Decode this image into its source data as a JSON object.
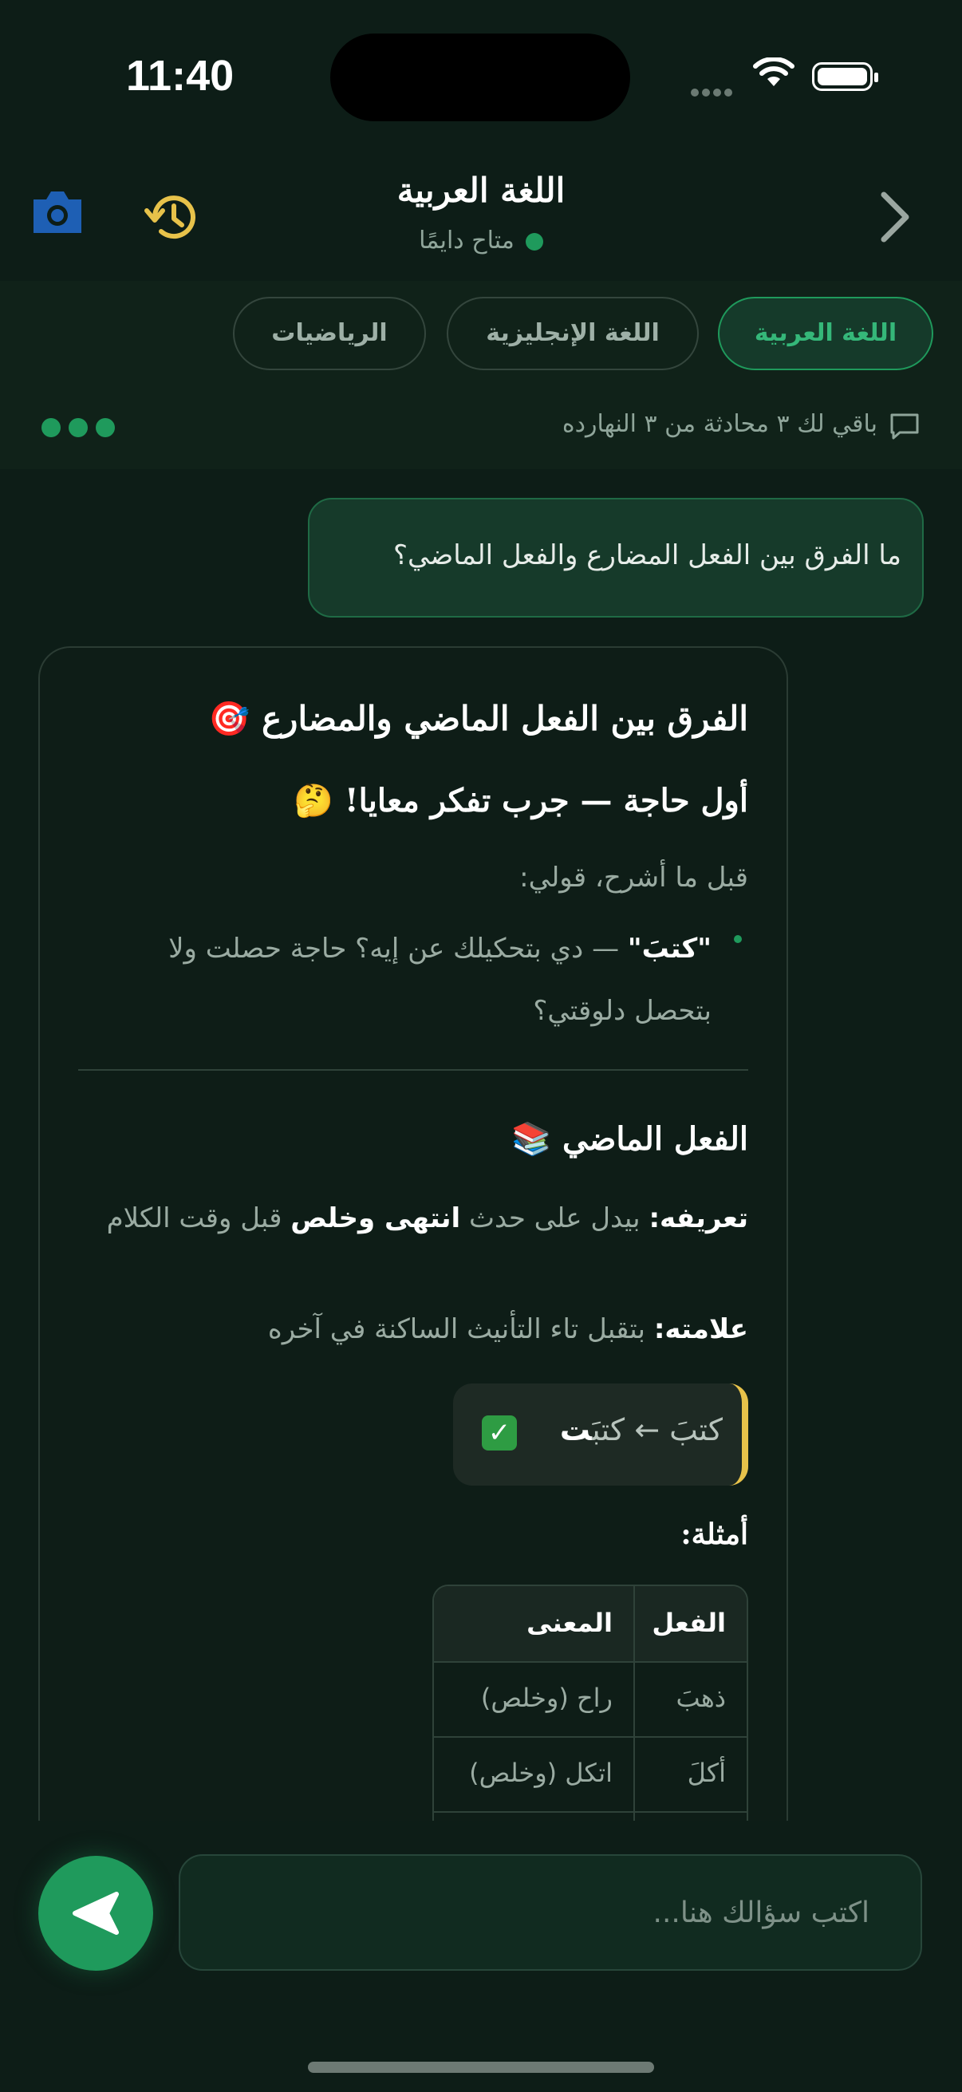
{
  "status_bar": {
    "time": "11:40"
  },
  "header": {
    "title": "اللغة العربية",
    "subtitle": "متاح دايمًا",
    "camera_icon": "camera-icon",
    "history_icon": "history-icon",
    "back_icon": "chevron-right-icon",
    "colors": {
      "camera": "#1e5fb4",
      "history": "#e7c24a",
      "online": "#1f9a5c"
    }
  },
  "tabs": [
    {
      "label": "اللغة العربية",
      "active": true
    },
    {
      "label": "اللغة الإنجليزية",
      "active": false
    },
    {
      "label": "الرياضيات",
      "active": false
    }
  ],
  "quota": {
    "text": "باقي لك ٣ محادثة من ٣ النهارده"
  },
  "user_message": {
    "text": "ما الفرق بين الفعل المضارع والفعل الماضي؟"
  },
  "assistant_message": {
    "heading": "الفرق بين الفعل الماضي والمضارع 🎯",
    "subheading": "أول حاجة — جرب تفكر معايا! 🤔",
    "intro": "قبل ما أشرح، قولي:",
    "bullet_bold": "\"كتبَ\"",
    "bullet_rest": " — دي بتحكيلك عن إيه؟ حاجة حصلت ولا بتحصل دلوقتي؟",
    "section_title": "الفعل الماضي 📚",
    "definition_label": "تعريفه:",
    "definition_1": " بيدل على حدث ",
    "definition_bold": "انتهى وخلص",
    "definition_2": " قبل وقت الكلام",
    "sign_label": "علامته:",
    "sign_text": " بتقبل تاء التأنيث الساكنة في آخره",
    "note_from": "كتبَ ← كتبَ",
    "note_bold": "ت",
    "examples_label": "أمثلة:",
    "table": {
      "headers": [
        "الفعل",
        "المعنى"
      ],
      "rows": [
        [
          "ذهبَ",
          "راح (وخلص)"
        ],
        [
          "أكلَ",
          "اتكل (وخلص)"
        ]
      ]
    }
  },
  "composer": {
    "placeholder": "اكتب سؤالك هنا...",
    "send_icon": "send-icon"
  }
}
